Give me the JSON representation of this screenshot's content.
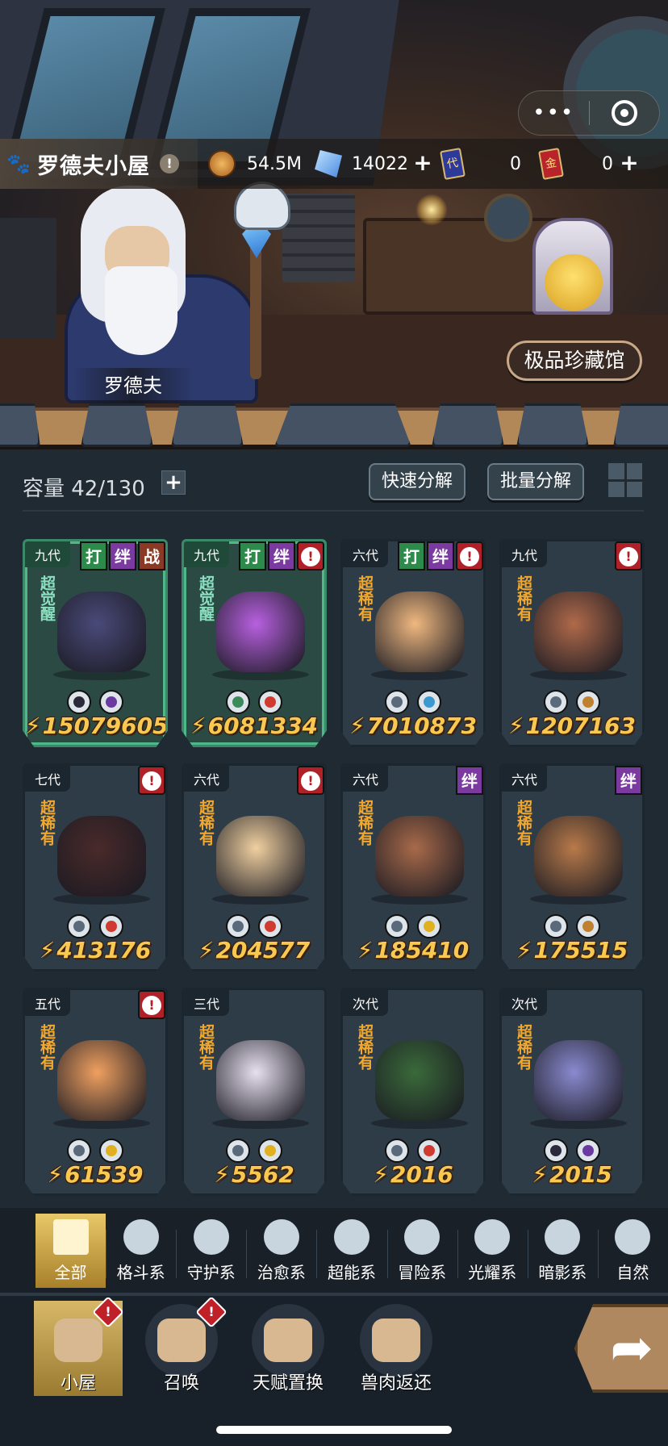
{
  "topbar": {
    "home_title": "罗德夫小屋",
    "warn_mark": "!",
    "gold": "54.5M",
    "crystal": "14022",
    "blue_card_label": "代",
    "blue_card_count": "0",
    "red_card_label": "金",
    "red_card_count": "0",
    "plus": "+"
  },
  "capsule": {
    "more": "•••"
  },
  "scene": {
    "npc_name": "罗德夫",
    "gallery_button": "极品珍藏馆"
  },
  "toolbar": {
    "capacity": "容量 42/130",
    "add": "+",
    "quick_decompose": "快速分解",
    "batch_decompose": "批量分解"
  },
  "pets": [
    {
      "gen": "九代",
      "rarity": "超觉醒",
      "awaken": true,
      "badges": [
        "打",
        "绊",
        "战"
      ],
      "power": "15079605",
      "types": [
        "#2a2a3a",
        "#6a3aa0"
      ],
      "color": "#4a4a7a"
    },
    {
      "gen": "九代",
      "rarity": "超觉醒",
      "awaken": true,
      "badges": [
        "打",
        "绊",
        "!"
      ],
      "power": "6081334",
      "types": [
        "#3a8a5a",
        "#d03a30"
      ],
      "color": "#b860e0"
    },
    {
      "gen": "六代",
      "rarity": "超稀有",
      "awaken": false,
      "badges": [
        "打",
        "绊",
        "!"
      ],
      "power": "7010873",
      "types": [
        "#5a6a7a",
        "#3a9ad0"
      ],
      "color": "#f0b880"
    },
    {
      "gen": "九代",
      "rarity": "超稀有",
      "awaken": false,
      "badges": [
        "!"
      ],
      "power": "1207163",
      "types": [
        "#5a6a7a",
        "#c08030"
      ],
      "color": "#b06a4a"
    },
    {
      "gen": "七代",
      "rarity": "超稀有",
      "awaken": false,
      "badges": [
        "!"
      ],
      "power": "413176",
      "types": [
        "#5a6a7a",
        "#d03a30"
      ],
      "color": "#4a2a2a"
    },
    {
      "gen": "六代",
      "rarity": "超稀有",
      "awaken": false,
      "badges": [
        "!"
      ],
      "power": "204577",
      "types": [
        "#5a6a7a",
        "#d03a30"
      ],
      "color": "#f0d0a0"
    },
    {
      "gen": "六代",
      "rarity": "超稀有",
      "awaken": false,
      "badges": [
        "绊"
      ],
      "power": "185410",
      "types": [
        "#5a6a7a",
        "#e0b020"
      ],
      "color": "#a86a4a"
    },
    {
      "gen": "六代",
      "rarity": "超稀有",
      "awaken": false,
      "badges": [
        "绊"
      ],
      "power": "175515",
      "types": [
        "#5a6a7a",
        "#c08030"
      ],
      "color": "#b87a4a"
    },
    {
      "gen": "五代",
      "rarity": "超稀有",
      "awaken": false,
      "badges": [
        "!"
      ],
      "power": "61539",
      "types": [
        "#5a6a7a",
        "#e0b020"
      ],
      "color": "#f0a060"
    },
    {
      "gen": "三代",
      "rarity": "超稀有",
      "awaken": false,
      "badges": [],
      "power": "5562",
      "types": [
        "#5a6a7a",
        "#e0b020"
      ],
      "color": "#e8e0f0"
    },
    {
      "gen": "次代",
      "rarity": "超稀有",
      "awaken": false,
      "badges": [],
      "power": "2016",
      "types": [
        "#5a6a7a",
        "#d03a30"
      ],
      "color": "#3a6a3a"
    },
    {
      "gen": "次代",
      "rarity": "超稀有",
      "awaken": false,
      "badges": [],
      "power": "2015",
      "types": [
        "#2a2a3a",
        "#6a3aa0"
      ],
      "color": "#8a8ad0"
    }
  ],
  "filters": [
    {
      "label": "全部",
      "icon": "all-icon"
    },
    {
      "label": "格斗系",
      "icon": "fist-icon"
    },
    {
      "label": "守护系",
      "icon": "shield-icon"
    },
    {
      "label": "治愈系",
      "icon": "sprout-icon"
    },
    {
      "label": "超能系",
      "icon": "psychic-icon"
    },
    {
      "label": "冒险系",
      "icon": "adventure-icon"
    },
    {
      "label": "光耀系",
      "icon": "star-icon"
    },
    {
      "label": "暗影系",
      "icon": "moon-icon"
    },
    {
      "label": "自然",
      "icon": "nature-icon"
    }
  ],
  "nav": [
    {
      "label": "小屋",
      "icon": "house-icon",
      "alert": true
    },
    {
      "label": "召唤",
      "icon": "egg-icon",
      "alert": true
    },
    {
      "label": "天赋置换",
      "icon": "swap-icon",
      "alert": false
    },
    {
      "label": "兽肉返还",
      "icon": "meat-icon",
      "alert": false
    }
  ],
  "colors": {
    "accent_gold": "#f8c850",
    "alert_red": "#c02028",
    "bg": "#202a32"
  }
}
